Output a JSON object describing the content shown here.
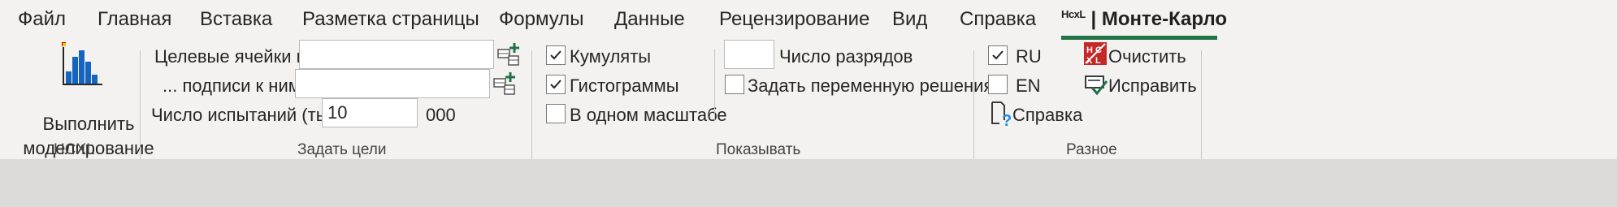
{
  "tabs": [
    "Файл",
    "Главная",
    "Вставка",
    "Разметка страницы",
    "Формулы",
    "Данные",
    "Рецензирование",
    "Вид",
    "Справка"
  ],
  "active_tab": {
    "prefix": "HcxL",
    "separator": "|",
    "label": "Монте-Карло"
  },
  "accent_color": "#217346",
  "groups": {
    "hcxl": {
      "run_button_line1": "Выполнить",
      "run_button_line2": "моделирование",
      "label": "HCXL"
    },
    "targets": {
      "target_cells_label": "Целевые ячейки и",
      "target_cells_value": "",
      "captions_label": "... подписи к ним",
      "captions_value": "",
      "trials_label": "Число испытаний (тыс)",
      "trials_value": "10",
      "trials_suffix": "000",
      "label": "Задать цели"
    },
    "show": {
      "cumulative": {
        "label": "Кумуляты",
        "checked": true
      },
      "histograms": {
        "label": "Гистограммы",
        "checked": true
      },
      "same_scale": {
        "label": "В одном масштабе",
        "checked": false
      },
      "digits_value": "",
      "digits_label": "Число разрядов",
      "decision_var": {
        "label": "Задать переменную решения",
        "checked": false
      },
      "label": "Показывать"
    },
    "misc": {
      "ru": {
        "label": "RU",
        "checked": true
      },
      "en": {
        "label": "EN",
        "checked": false
      },
      "help_label": "Справка",
      "clear_label": "Очистить",
      "fix_label": "Исправить",
      "label": "Разное"
    }
  }
}
